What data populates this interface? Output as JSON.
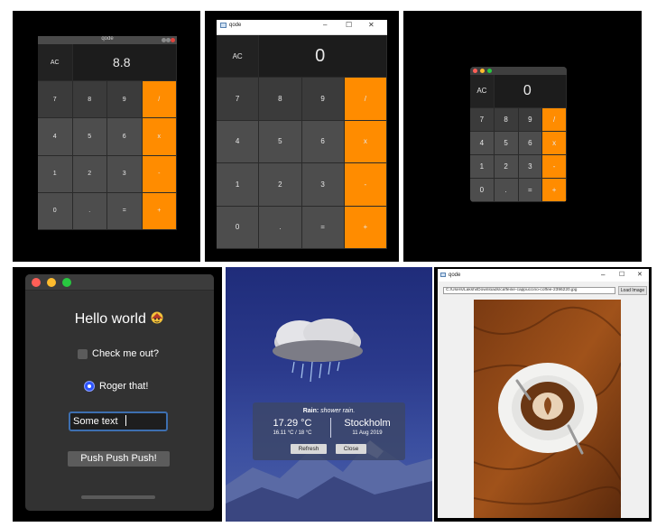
{
  "calc1": {
    "title": "qode",
    "display": "8.8",
    "rows": [
      [
        "AC",
        "",
        "",
        ""
      ],
      [
        "7",
        "8",
        "9",
        "/"
      ],
      [
        "4",
        "5",
        "6",
        "x"
      ],
      [
        "1",
        "2",
        "3",
        "-"
      ],
      [
        "0",
        ".",
        "=",
        "+"
      ]
    ],
    "colors": {
      "operator": "#ff8c00",
      "key": "#3b3b3b",
      "display": "#1c1c1c"
    }
  },
  "calc2": {
    "title": "qode",
    "display": "0",
    "minimize": "–",
    "maximize": "☐",
    "close": "✕",
    "rows": [
      [
        "AC",
        "",
        "",
        ""
      ],
      [
        "7",
        "8",
        "9",
        "/"
      ],
      [
        "4",
        "5",
        "6",
        "x"
      ],
      [
        "1",
        "2",
        "3",
        "-"
      ],
      [
        "0",
        ".",
        "=",
        "+"
      ]
    ]
  },
  "calc3": {
    "display": "0",
    "rows": [
      [
        "AC",
        "",
        "",
        ""
      ],
      [
        "7",
        "8",
        "9",
        "/"
      ],
      [
        "4",
        "5",
        "6",
        "x"
      ],
      [
        "1",
        "2",
        "3",
        "-"
      ],
      [
        "0",
        ".",
        "=",
        "+"
      ]
    ]
  },
  "hello": {
    "title": "Hello world",
    "title_icon": "face-emoji-icon",
    "checkbox_label": "Check me out?",
    "checkbox_checked": false,
    "radio_label": "Roger that!",
    "radio_checked": true,
    "textfield_value": "Some text",
    "button_label": "Push Push Push!",
    "colors": {
      "accent": "#2c54ff",
      "focus": "#3d6fb0"
    }
  },
  "weather": {
    "condition_label": "Rain:",
    "condition_desc": "shower rain.",
    "temperature": "17.29 °C",
    "temp_range": "16.11 °C / 18 °C",
    "city": "Stockholm",
    "date": "11 Aug 2019",
    "refresh_label": "Refresh",
    "close_label": "Close",
    "icon": "rain-cloud-icon"
  },
  "viewer": {
    "title": "qode",
    "minimize": "–",
    "maximize": "☐",
    "close": "✕",
    "path": "C:/Users/Lakshi/Downloads/caffeine-cappuccino-coffee-2396220.jpg",
    "load_label": "Load Image",
    "image_subject": "coffee-cup-photo"
  }
}
